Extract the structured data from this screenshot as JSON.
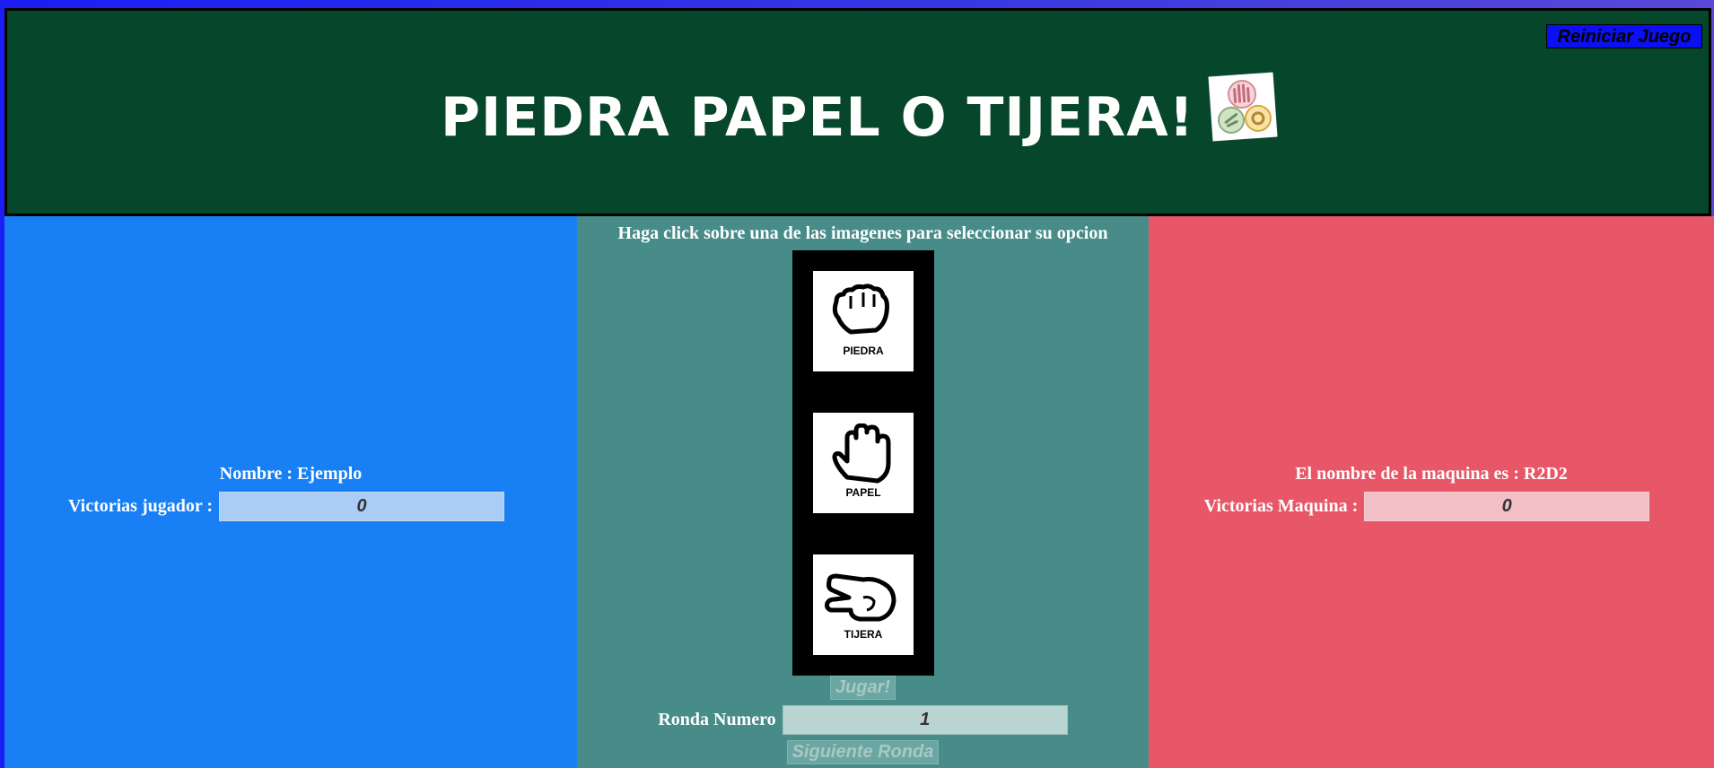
{
  "header": {
    "title": "PIEDRA PAPEL O TIJERA!",
    "reset_label": "Reiniciar Juego"
  },
  "player": {
    "name_label": "Nombre : Ejemplo",
    "wins_label": "Victorias jugador :",
    "wins_value": "0"
  },
  "center": {
    "instruction": "Haga click sobre una de las imagenes para seleccionar su opcion",
    "choices": [
      {
        "label": "PIEDRA",
        "icon": "fist-icon"
      },
      {
        "label": "PAPEL",
        "icon": "open-hand-icon"
      },
      {
        "label": "TIJERA",
        "icon": "scissors-hand-icon"
      }
    ],
    "play_label": "Jugar!",
    "round_label": "Ronda Numero",
    "round_value": "1",
    "next_round_label": "Siguiente Ronda"
  },
  "machine": {
    "name_label": "El nombre de la maquina es : R2D2",
    "wins_label": "Victorias Maquina :",
    "wins_value": "0"
  },
  "colors": {
    "header_bg": "#06462a",
    "player_panel": "#1880f4",
    "center_panel": "#478c89",
    "machine_panel": "#e75767",
    "reset_button": "#0a10f2"
  }
}
